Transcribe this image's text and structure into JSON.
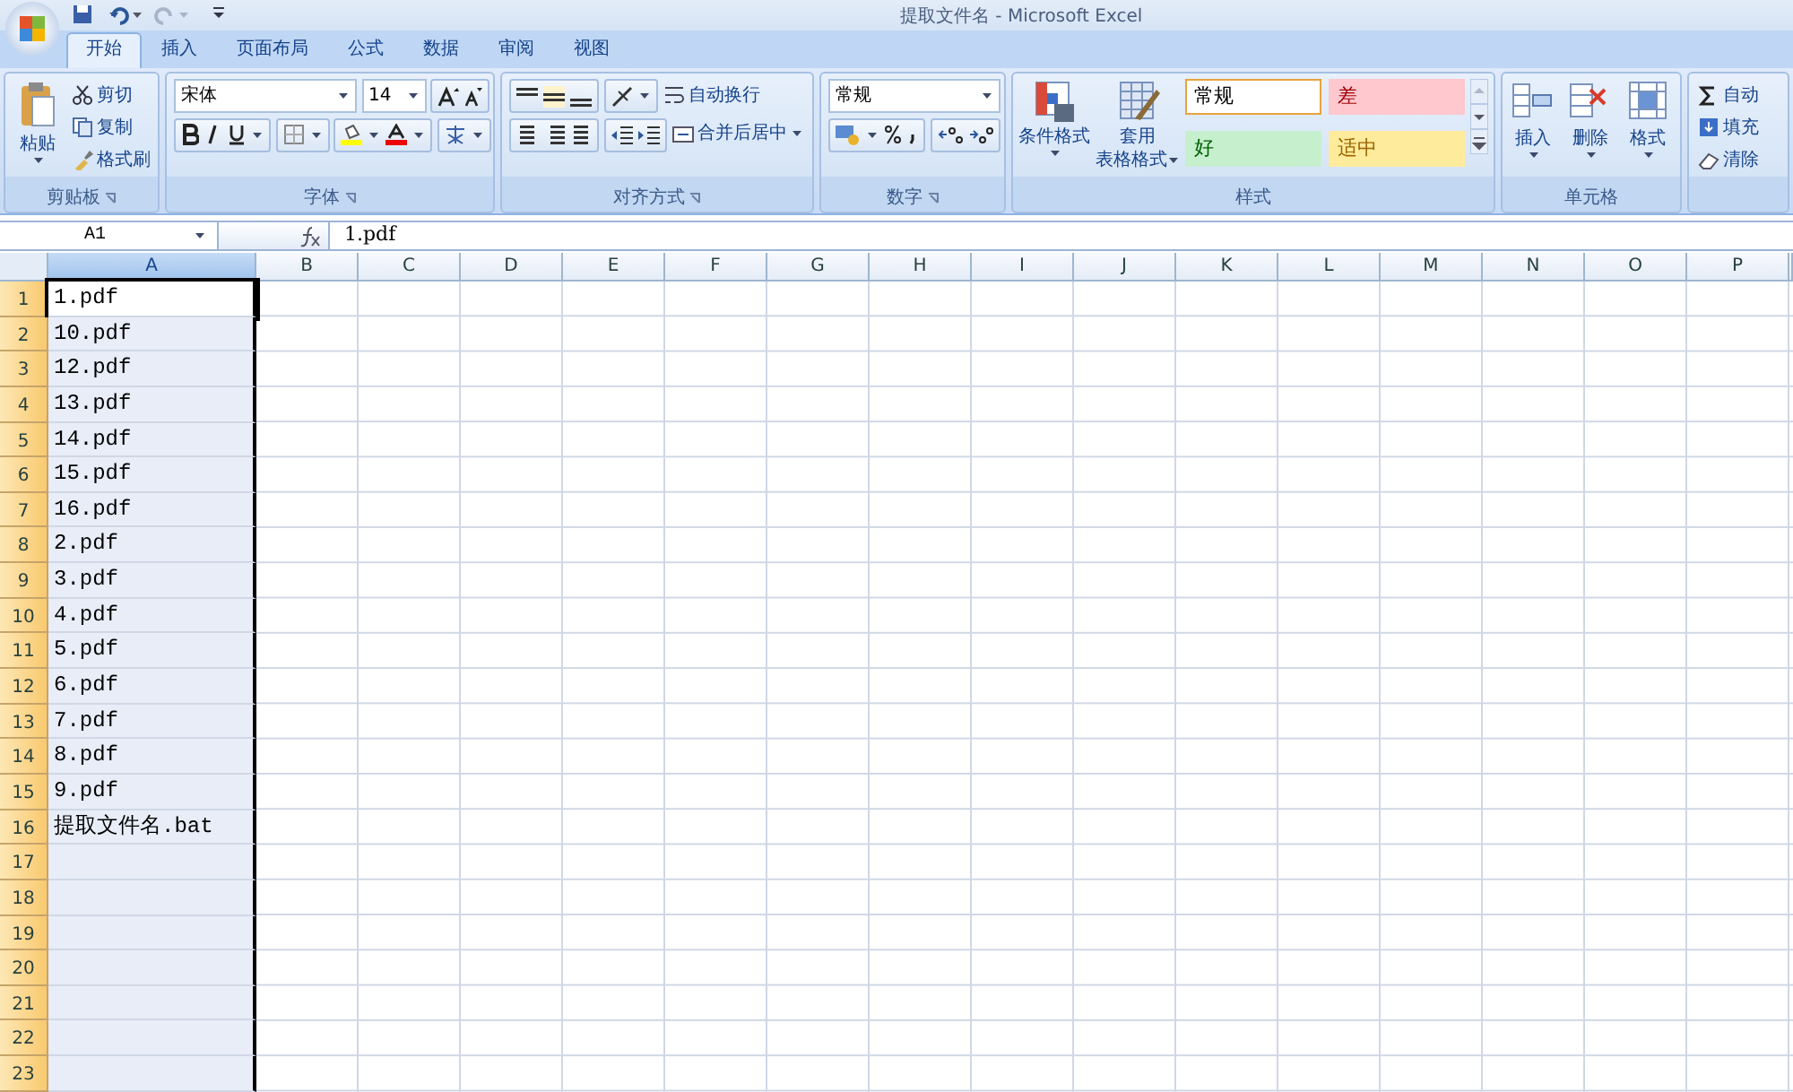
{
  "window": {
    "title": "提取文件名 - Microsoft Excel"
  },
  "tabs": [
    {
      "label": "开始",
      "selected": true
    },
    {
      "label": "插入",
      "selected": false
    },
    {
      "label": "页面布局",
      "selected": false
    },
    {
      "label": "公式",
      "selected": false
    },
    {
      "label": "数据",
      "selected": false
    },
    {
      "label": "审阅",
      "selected": false
    },
    {
      "label": "视图",
      "selected": false
    }
  ],
  "ribbon": {
    "clipboard": {
      "label": "剪贴板",
      "paste": "粘贴",
      "items": [
        "剪切",
        "复制",
        "格式刷"
      ]
    },
    "font": {
      "label": "字体",
      "font_name": "宋体",
      "font_size": "14"
    },
    "alignment": {
      "label": "对齐方式",
      "wrap": "自动换行",
      "merge": "合并后居中"
    },
    "number": {
      "label": "数字",
      "format": "常规"
    },
    "styles": {
      "label": "样式",
      "conditional": "条件格式",
      "table_lines": [
        "套用",
        "表格格式"
      ],
      "cell_styles": [
        {
          "label": "常规",
          "color": "#ffffff"
        },
        {
          "label": "差",
          "color": "#ffc7ce"
        },
        {
          "label": "好",
          "color": "#c6efce"
        },
        {
          "label": "适中",
          "color": "#ffeb9c"
        }
      ]
    },
    "cells": {
      "label": "单元格",
      "buttons": [
        "插入",
        "删除",
        "格式"
      ]
    },
    "editing": {
      "items": [
        "自动",
        "填充",
        "清除"
      ]
    }
  },
  "formula_bar": {
    "name_box": "A1",
    "content": "1.pdf"
  },
  "sheet": {
    "columns": [
      {
        "label": "A",
        "selected": true
      },
      {
        "label": "B",
        "selected": false
      },
      {
        "label": "C",
        "selected": false
      },
      {
        "label": "D",
        "selected": false
      },
      {
        "label": "E",
        "selected": false
      },
      {
        "label": "F",
        "selected": false
      },
      {
        "label": "G",
        "selected": false
      },
      {
        "label": "H",
        "selected": false
      },
      {
        "label": "I",
        "selected": false
      },
      {
        "label": "J",
        "selected": false
      },
      {
        "label": "K",
        "selected": false
      },
      {
        "label": "L",
        "selected": false
      },
      {
        "label": "M",
        "selected": false
      },
      {
        "label": "N",
        "selected": false
      },
      {
        "label": "O",
        "selected": false
      },
      {
        "label": "P",
        "selected": false
      }
    ],
    "rows": [
      {
        "number": "1",
        "value": "1.pdf",
        "active": true
      },
      {
        "number": "2",
        "value": "10.pdf",
        "active": false
      },
      {
        "number": "3",
        "value": "12.pdf",
        "active": false
      },
      {
        "number": "4",
        "value": "13.pdf",
        "active": false
      },
      {
        "number": "5",
        "value": "14.pdf",
        "active": false
      },
      {
        "number": "6",
        "value": "15.pdf",
        "active": false
      },
      {
        "number": "7",
        "value": "16.pdf",
        "active": false
      },
      {
        "number": "8",
        "value": "2.pdf",
        "active": false
      },
      {
        "number": "9",
        "value": "3.pdf",
        "active": false
      },
      {
        "number": "10",
        "value": "4.pdf",
        "active": false
      },
      {
        "number": "11",
        "value": "5.pdf",
        "active": false
      },
      {
        "number": "12",
        "value": "6.pdf",
        "active": false
      },
      {
        "number": "13",
        "value": "7.pdf",
        "active": false
      },
      {
        "number": "14",
        "value": "8.pdf",
        "active": false
      },
      {
        "number": "15",
        "value": "9.pdf",
        "active": false
      },
      {
        "number": "16",
        "value": "提取文件名.bat",
        "active": false
      },
      {
        "number": "17",
        "active": false
      },
      {
        "number": "18",
        "active": false
      },
      {
        "number": "19",
        "active": false
      },
      {
        "number": "20",
        "active": false
      },
      {
        "number": "21",
        "active": false
      },
      {
        "number": "22",
        "active": false
      },
      {
        "number": "23",
        "active": false
      }
    ]
  }
}
